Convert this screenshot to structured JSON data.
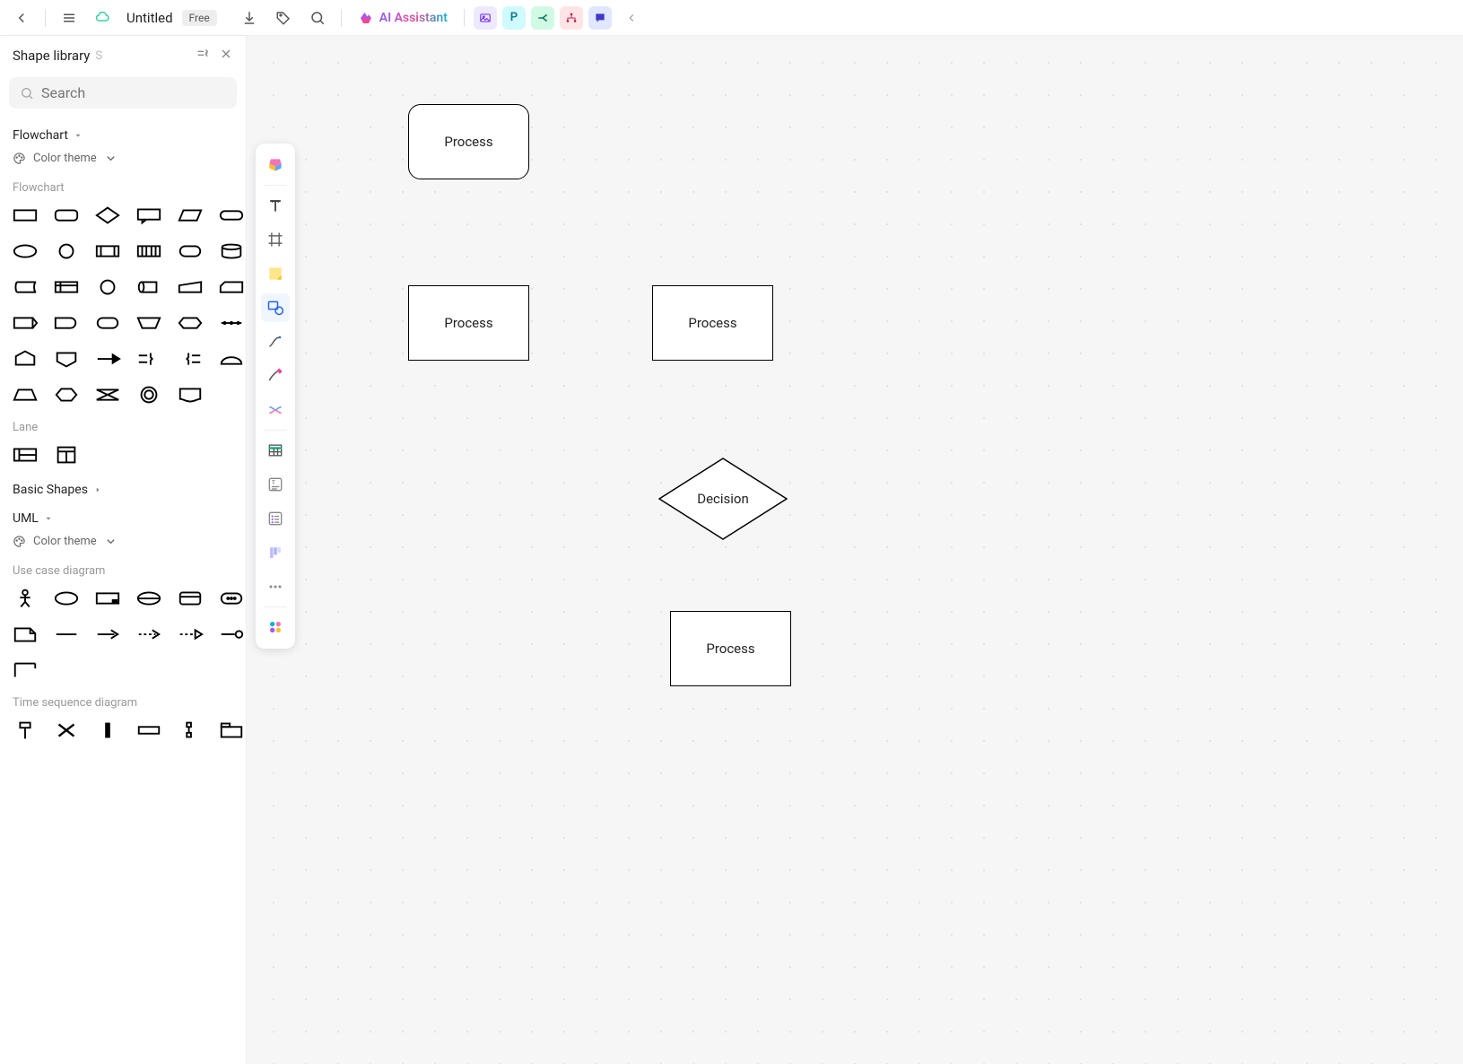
{
  "topbar": {
    "doc_title": "Untitled",
    "free_badge": "Free",
    "ai_label": "AI Assistant",
    "chips": {
      "p": "P"
    }
  },
  "panel": {
    "title": "Shape library",
    "shortcut": "S",
    "search_placeholder": "Search",
    "sections": {
      "flowchart": "Flowchart",
      "basic_shapes": "Basic Shapes",
      "uml": "UML"
    },
    "color_theme": "Color theme",
    "subheads": {
      "flowchart": "Flowchart",
      "lane": "Lane",
      "usecase": "Use case diagram",
      "timeseq": "Time sequence diagram"
    }
  },
  "canvas_nodes": {
    "n1": "Process",
    "n2": "Process",
    "n3": "Process",
    "n4": "Decision",
    "n5": "Process"
  }
}
